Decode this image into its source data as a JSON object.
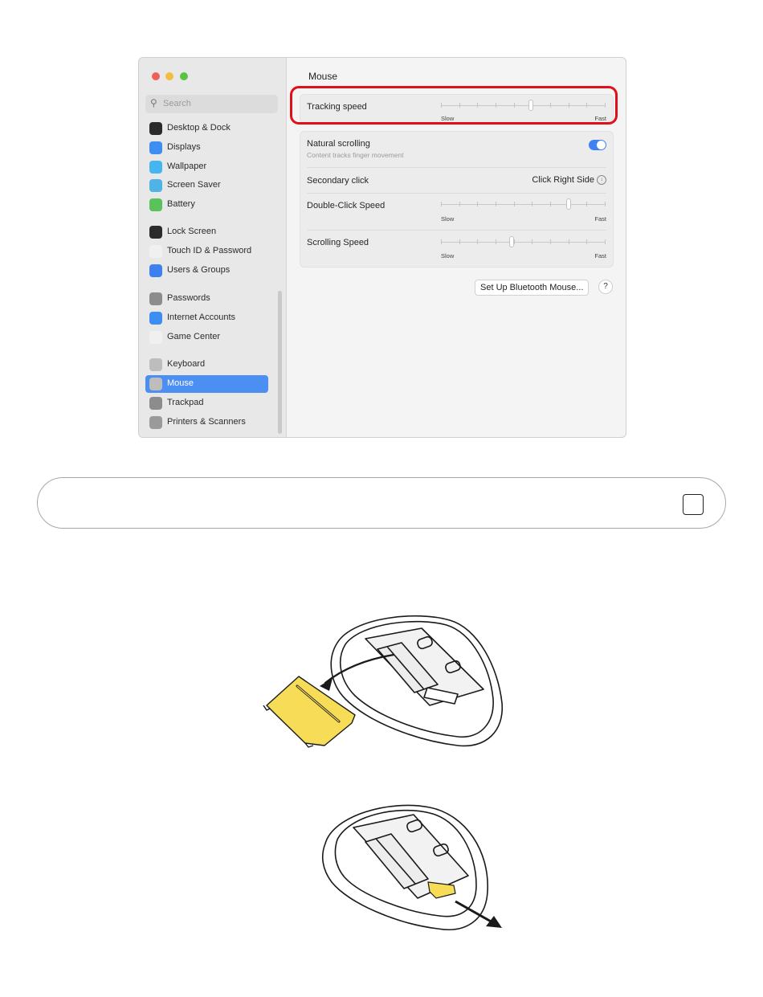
{
  "window": {
    "search_placeholder": "Search",
    "sidebar": {
      "items": [
        {
          "label": "Desktop & Dock",
          "icon": "dock-icon",
          "color": "#2b2b2b"
        },
        {
          "label": "Displays",
          "icon": "displays-icon",
          "color": "#3d8ef0"
        },
        {
          "label": "Wallpaper",
          "icon": "wallpaper-icon",
          "color": "#47b5f0"
        },
        {
          "label": "Screen Saver",
          "icon": "screen-saver-icon",
          "color": "#4fb3e6"
        },
        {
          "label": "Battery",
          "icon": "battery-icon",
          "color": "#59c25a"
        },
        {
          "label": "Lock Screen",
          "icon": "lock-icon",
          "color": "#2b2b2b"
        },
        {
          "label": "Touch ID & Password",
          "icon": "fingerprint-icon",
          "color": "#f0f0f0"
        },
        {
          "label": "Users & Groups",
          "icon": "users-icon",
          "color": "#3d80f0"
        },
        {
          "label": "Passwords",
          "icon": "key-icon",
          "color": "#8c8c8c"
        },
        {
          "label": "Internet Accounts",
          "icon": "at-icon",
          "color": "#3d8ef0"
        },
        {
          "label": "Game Center",
          "icon": "game-center-icon",
          "color": "#f0f0f0"
        },
        {
          "label": "Keyboard",
          "icon": "keyboard-icon",
          "color": "#bdbdbd"
        },
        {
          "label": "Mouse",
          "icon": "mouse-icon",
          "color": "#bdbdbd",
          "selected": true
        },
        {
          "label": "Trackpad",
          "icon": "trackpad-icon",
          "color": "#8c8c8c"
        },
        {
          "label": "Printers & Scanners",
          "icon": "printer-icon",
          "color": "#9a9a9a"
        }
      ]
    },
    "content": {
      "title": "Mouse",
      "tracking_speed": {
        "label": "Tracking speed",
        "min_label": "Slow",
        "max_label": "Fast",
        "level": 0.55
      },
      "natural_scrolling": {
        "label": "Natural scrolling",
        "sublabel": "Content tracks finger movement",
        "enabled": true
      },
      "secondary_click": {
        "label": "Secondary click",
        "value": "Click Right Side"
      },
      "double_click_speed": {
        "label": "Double-Click Speed",
        "min_label": "Slow",
        "max_label": "Fast",
        "level": 0.78
      },
      "scrolling_speed": {
        "label": "Scrolling Speed",
        "min_label": "Slow",
        "max_label": "Fast",
        "level": 0.43
      },
      "bluetooth_button": "Set Up Bluetooth Mouse...",
      "help_button": "?"
    }
  },
  "colors": {
    "highlight": "#e0101a",
    "accent": "#3f81f0",
    "battery_cover": "#f7dd57"
  }
}
